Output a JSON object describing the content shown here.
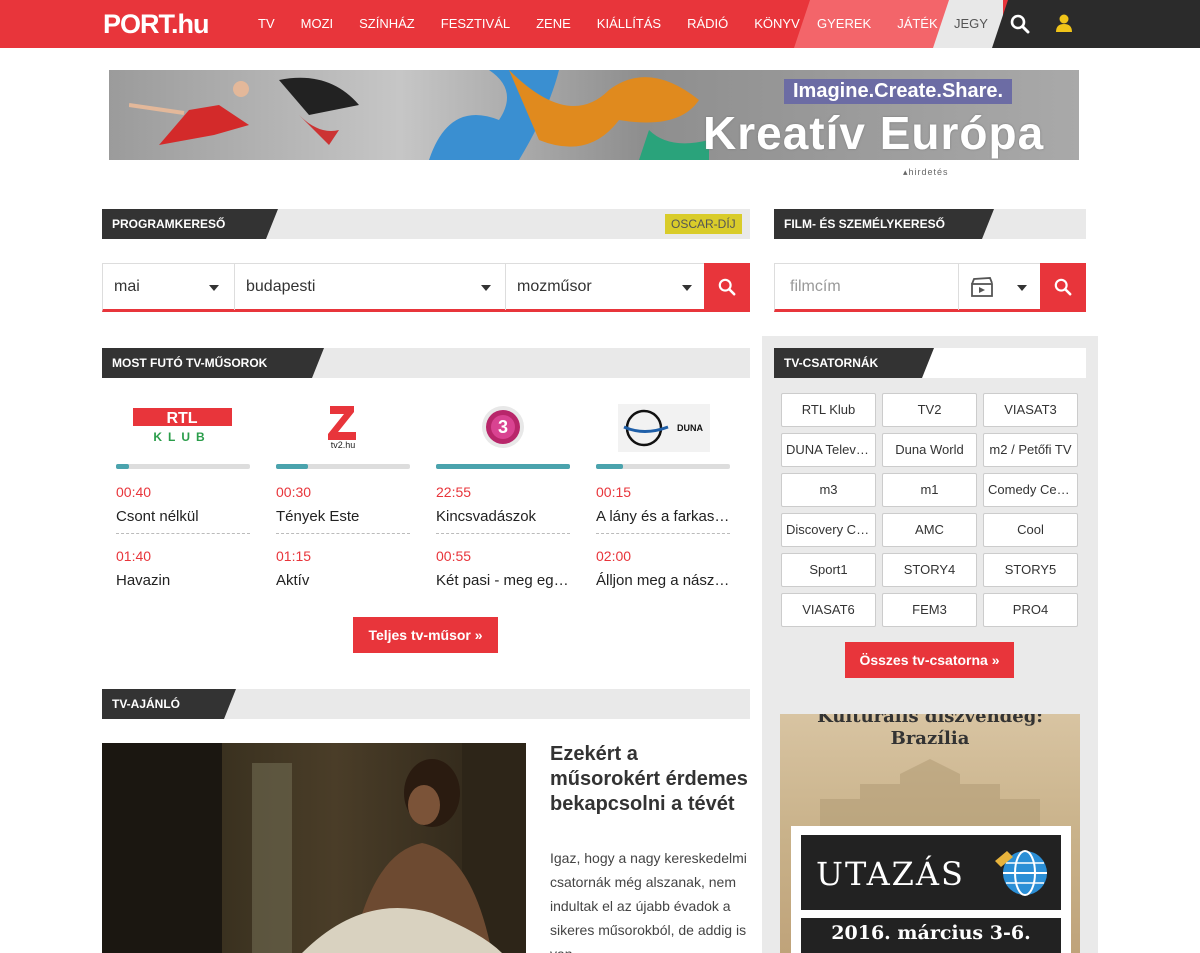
{
  "nav": {
    "logo": "PORT.hu",
    "items": [
      "TV",
      "MOZI",
      "SZÍNHÁZ",
      "FESZTIVÁL",
      "ZENE",
      "KIÁLLÍTÁS",
      "RÁDIÓ",
      "KÖNYV"
    ],
    "kids_items": [
      "GYEREK",
      "JÁTÉK"
    ],
    "ticket": "JEGY",
    "search_icon": "search-icon",
    "user_icon": "user-icon",
    "accent": "#e8353b"
  },
  "banner": {
    "tagline": "Imagine.Create.Share.",
    "headline": "Kreatív Európa",
    "ad_label": "▴hirdetés"
  },
  "program_search": {
    "header": "PROGRAMKERESŐ",
    "oscar_badge": "OSCAR-DÍJ",
    "day": "mai",
    "city": "budapesti",
    "type": "mozműsor"
  },
  "film_search": {
    "header": "FILM- ÉS SZEMÉLYKERESŐ",
    "placeholder": "filmcím"
  },
  "running": {
    "header": "MOST FUTÓ TV-MŰSOROK",
    "channels": [
      {
        "logo": "RTL KLUB",
        "progress": 0.1,
        "t1": "00:40",
        "n1": "Csont nélkül",
        "t2": "01:40",
        "n2": "Havazin"
      },
      {
        "logo": "tv2.hu",
        "progress": 0.24,
        "t1": "00:30",
        "n1": "Tények Este",
        "t2": "01:15",
        "n2": "Aktív"
      },
      {
        "logo": "3",
        "progress": 1.0,
        "t1": "22:55",
        "n1": "Kincsvadászok",
        "t2": "00:55",
        "n2": "Két pasi - meg egy kicsi"
      },
      {
        "logo": "DUNA",
        "progress": 0.2,
        "t1": "00:15",
        "n1": "A lány és a farkasok",
        "t2": "02:00",
        "n2": "Álljon meg a násznép!"
      }
    ],
    "full_button": "Teljes tv-műsor »"
  },
  "tv_channels": {
    "header": "TV-CSATORNÁK",
    "list": [
      "RTL Klub",
      "TV2",
      "VIASAT3",
      "DUNA Televízió",
      "Duna World",
      "m2 / Petőfi TV",
      "m3",
      "m1",
      "Comedy Central",
      "Discovery Channel",
      "AMC",
      "Cool",
      "Sport1",
      "STORY4",
      "STORY5",
      "VIASAT6",
      "FEM3",
      "PRO4"
    ],
    "all_button": "Összes tv-csatorna »"
  },
  "recommend": {
    "header": "TV-AJÁNLÓ",
    "title": "Ezekért a műsorokért érdemes bekapcsolni a tévét",
    "text": "Igaz, hogy a nagy kereskedelmi csatornák még alszanak, nem indultak el az újabb évadok a sikeres műsorokból, de addig is van"
  },
  "side_ad": {
    "line1": "Kulturális díszvendég:",
    "line2": "Brazília",
    "title": "UTAZÁS",
    "date": "2016. március 3-6."
  }
}
